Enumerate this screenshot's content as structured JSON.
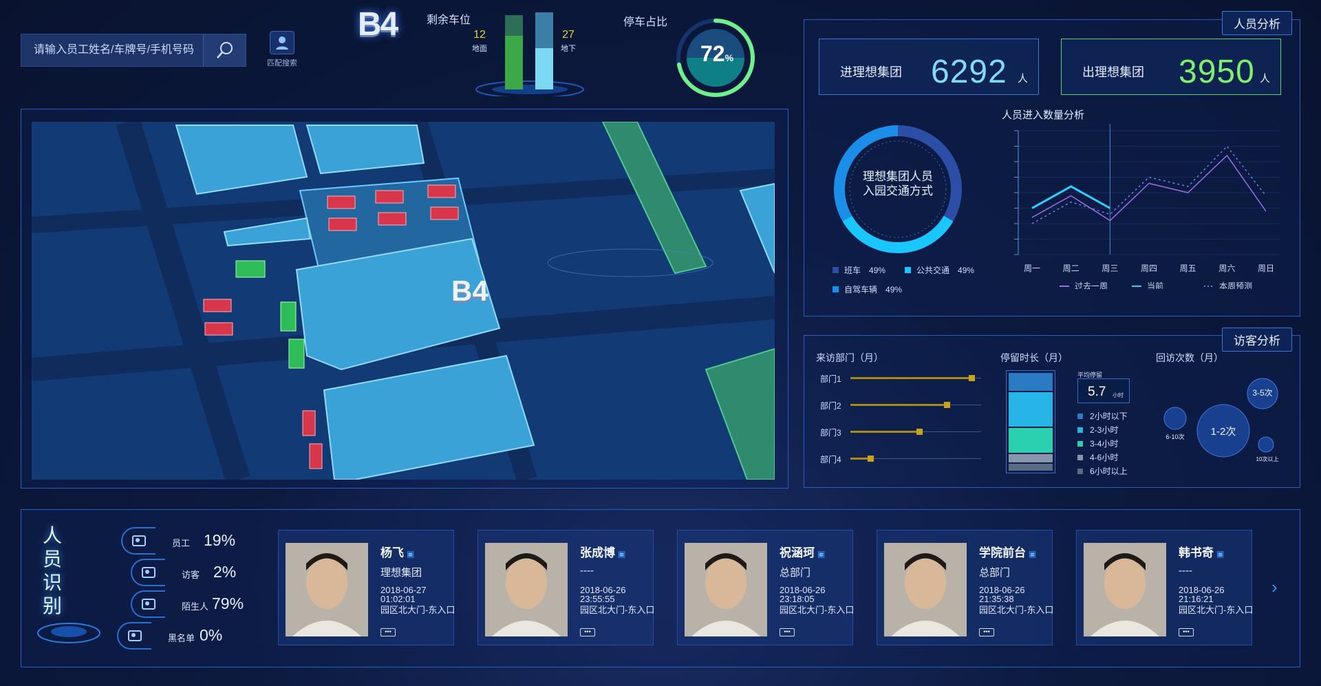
{
  "search": {
    "placeholder": "请输入员工姓名/车牌号/手机号码",
    "match_label": "匹配搜索"
  },
  "parking": {
    "level": "B4",
    "remaining_label": "剩余车位",
    "ground_count": "12",
    "ground_label": "地面",
    "underground_count": "27",
    "underground_label": "地下",
    "occupancy_label": "停车占比",
    "occupancy_value": "72",
    "occupancy_unit": "%",
    "occupancy_fraction": 0.72
  },
  "map": {
    "building_label": "B4"
  },
  "personnel": {
    "title": "人员分析",
    "enter_label": "进理想集团",
    "enter_value": "6292",
    "exit_label": "出理想集团",
    "exit_value": "3950",
    "unit": "人",
    "donut_title_line1": "理想集团人员",
    "donut_title_line2": "入园交通方式",
    "legend": [
      {
        "label": "班车",
        "value": "49%",
        "color": "#2d4ea6"
      },
      {
        "label": "公共交通",
        "value": "49%",
        "color": "#19c6ff"
      },
      {
        "label": "自驾车辆",
        "value": "49%",
        "color": "#1a8ee8"
      }
    ],
    "line_title": "人员进入数量分析",
    "line_legend": [
      "过去一周",
      "当前",
      "本周预测"
    ]
  },
  "visitor": {
    "title": "访客分析",
    "dept_title": "来访部门（月）",
    "stay_title": "停留时长（月）",
    "avg_label": "平均停留",
    "avg_value": "5.7",
    "avg_unit": "小时",
    "return_title": "回访次数（月）",
    "departments": [
      {
        "name": "部门1",
        "value": 0.93
      },
      {
        "name": "部门2",
        "value": 0.74
      },
      {
        "name": "部门3",
        "value": 0.53
      },
      {
        "name": "部门4",
        "value": 0.16
      }
    ],
    "stay_legend": [
      {
        "label": "2小时以下",
        "color": "#2a7bc4"
      },
      {
        "label": "2-3小时",
        "color": "#27b4e6"
      },
      {
        "label": "3-4小时",
        "color": "#2ad0b0"
      },
      {
        "label": "4-6小时",
        "color": "#8796ad"
      },
      {
        "label": "6小时以上",
        "color": "#5a6b86"
      }
    ],
    "bubbles": [
      {
        "label": "3-5次"
      },
      {
        "label": "6-10次"
      },
      {
        "label": "1-2次"
      },
      {
        "label": "10次以上"
      }
    ]
  },
  "chart_data": [
    {
      "type": "pie",
      "title": "理想集团人员入园交通方式",
      "categories": [
        "班车",
        "公共交通",
        "自驾车辆"
      ],
      "values": [
        49,
        49,
        49
      ]
    },
    {
      "type": "line",
      "title": "人员进入数量分析",
      "categories": [
        "周一",
        "周二",
        "周三",
        "周四",
        "周五",
        "周六",
        "周日"
      ],
      "series": [
        {
          "name": "过去一周",
          "values": [
            12,
            19,
            11,
            23,
            20,
            32,
            14
          ]
        },
        {
          "name": "当前",
          "values": [
            15,
            22,
            15
          ]
        },
        {
          "name": "本周预测",
          "values": [
            10,
            17,
            13,
            25,
            22,
            35,
            19
          ]
        }
      ]
    }
  ],
  "recognition": {
    "title_chars": [
      "人",
      "员",
      "识",
      "别"
    ],
    "categories": [
      {
        "name": "员工",
        "value": "19%"
      },
      {
        "name": "访客",
        "value": "2%"
      },
      {
        "name": "陌生人",
        "value": "79%"
      },
      {
        "name": "黑名单",
        "value": "0%"
      }
    ]
  },
  "people": [
    {
      "name": "杨飞",
      "org": "理想集团",
      "date": "2018-06-27",
      "time": "01:02:01",
      "location": "园区北大门-东入口"
    },
    {
      "name": "张成博",
      "org": "----",
      "date": "2018-06-26",
      "time": "23:55:55",
      "location": "园区北大门-东入口"
    },
    {
      "name": "祝涵珂",
      "org": "总部门",
      "date": "2018-06-26",
      "time": "23:18:05",
      "location": "园区北大门-东入口"
    },
    {
      "name": "学院前台",
      "org": "总部门",
      "date": "2018-06-26",
      "time": "21:35:38",
      "location": "园区北大门-东入口"
    },
    {
      "name": "韩书奇",
      "org": "----",
      "date": "2018-06-26",
      "time": "21:16:21",
      "location": "园区北大门-东入口"
    }
  ],
  "more_label": "•••"
}
